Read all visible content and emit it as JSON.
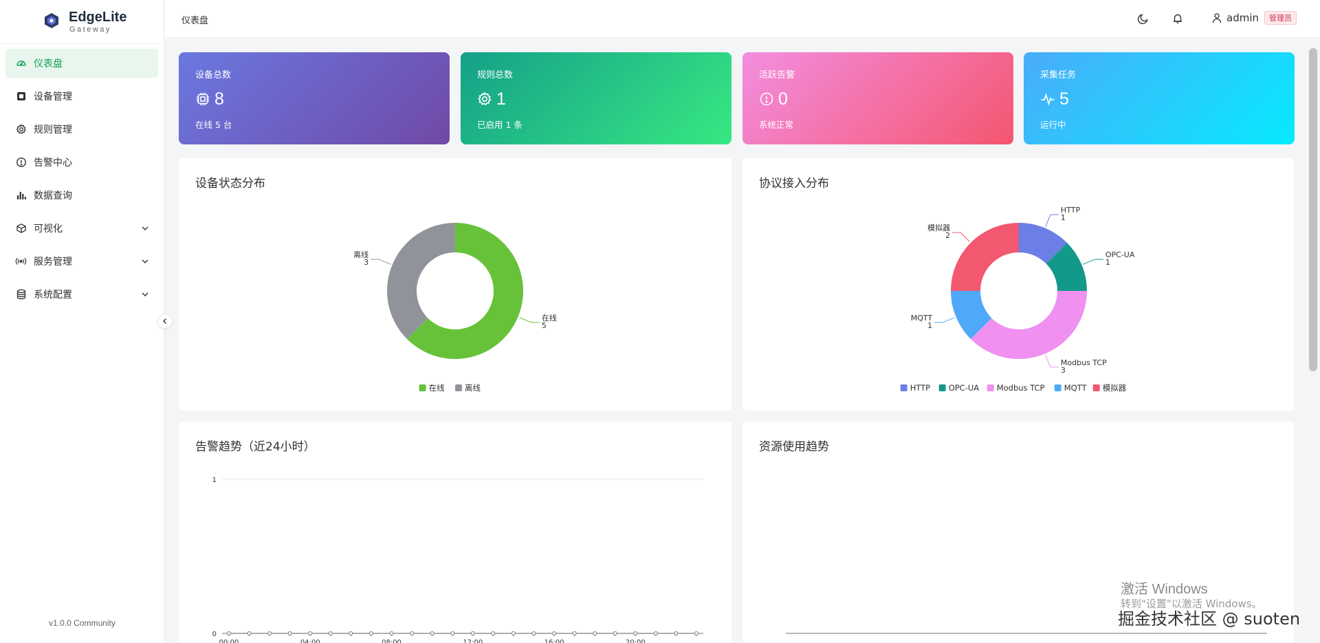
{
  "app": {
    "name": "EdgeLite",
    "subtitle": "Gateway",
    "version": "v1.0.0 Community"
  },
  "sidebar": {
    "items": [
      {
        "label": "仪表盘",
        "icon": "dashboard-icon",
        "active": true
      },
      {
        "label": "设备管理",
        "icon": "chip-icon"
      },
      {
        "label": "规则管理",
        "icon": "gear-icon"
      },
      {
        "label": "告警中心",
        "icon": "alert-circle-icon"
      },
      {
        "label": "数据查询",
        "icon": "bar-chart-icon"
      },
      {
        "label": "可视化",
        "icon": "cube-icon",
        "expandable": true
      },
      {
        "label": "服务管理",
        "icon": "broadcast-icon",
        "expandable": true
      },
      {
        "label": "系统配置",
        "icon": "database-icon",
        "expandable": true
      }
    ]
  },
  "header": {
    "breadcrumb": "仪表盘",
    "user": "admin",
    "role": "管理员"
  },
  "stats": [
    {
      "title": "设备总数",
      "value": "8",
      "sub": "在线 5 台",
      "icon": "chip-icon"
    },
    {
      "title": "规则总数",
      "value": "1",
      "sub": "已启用 1 条",
      "icon": "gear-icon"
    },
    {
      "title": "活跃告警",
      "value": "0",
      "sub": "系统正常",
      "icon": "alert-circle-icon"
    },
    {
      "title": "采集任务",
      "value": "5",
      "sub": "运行中",
      "icon": "pulse-icon"
    }
  ],
  "panels": {
    "device_status": "设备状态分布",
    "protocol": "协议接入分布",
    "alarm_trend": "告警趋势（近24小时）",
    "resource": "资源使用趋势"
  },
  "chart_data": [
    {
      "type": "pie",
      "title": "设备状态分布",
      "categories": [
        "在线",
        "离线"
      ],
      "values": [
        5,
        3
      ],
      "colors": [
        "#67c23a",
        "#909399"
      ],
      "legend": "bottom"
    },
    {
      "type": "pie",
      "title": "协议接入分布",
      "categories": [
        "HTTP",
        "OPC-UA",
        "Modbus TCP",
        "MQTT",
        "模拟器"
      ],
      "values": [
        1,
        1,
        3,
        1,
        2
      ],
      "colors": [
        "#6c7fe6",
        "#13998a",
        "#f090f0",
        "#4fa9f8",
        "#f25870"
      ],
      "legend": "bottom"
    },
    {
      "type": "line",
      "title": "告警趋势（近24小时）",
      "x": [
        "00:00",
        "01:00",
        "02:00",
        "03:00",
        "04:00",
        "05:00",
        "06:00",
        "07:00",
        "08:00",
        "09:00",
        "10:00",
        "11:00",
        "12:00",
        "13:00",
        "14:00",
        "15:00",
        "16:00",
        "17:00",
        "18:00",
        "19:00",
        "20:00",
        "21:00",
        "22:00",
        "23:00"
      ],
      "x_tick_labels": [
        "00:00",
        "04:00",
        "08:00",
        "12:00",
        "16:00",
        "20:00"
      ],
      "values": [
        0,
        0,
        0,
        0,
        0,
        0,
        0,
        0,
        0,
        0,
        0,
        0,
        0,
        0,
        0,
        0,
        0,
        0,
        0,
        0,
        0,
        0,
        0,
        0
      ],
      "ylim": [
        0,
        1
      ],
      "y_ticks": [
        "0",
        "1"
      ],
      "grid": true
    }
  ],
  "watermark": {
    "line1": "激活 Windows",
    "line2": "转到\"设置\"以激活 Windows。",
    "line3": "掘金技术社区 @ suoten"
  }
}
